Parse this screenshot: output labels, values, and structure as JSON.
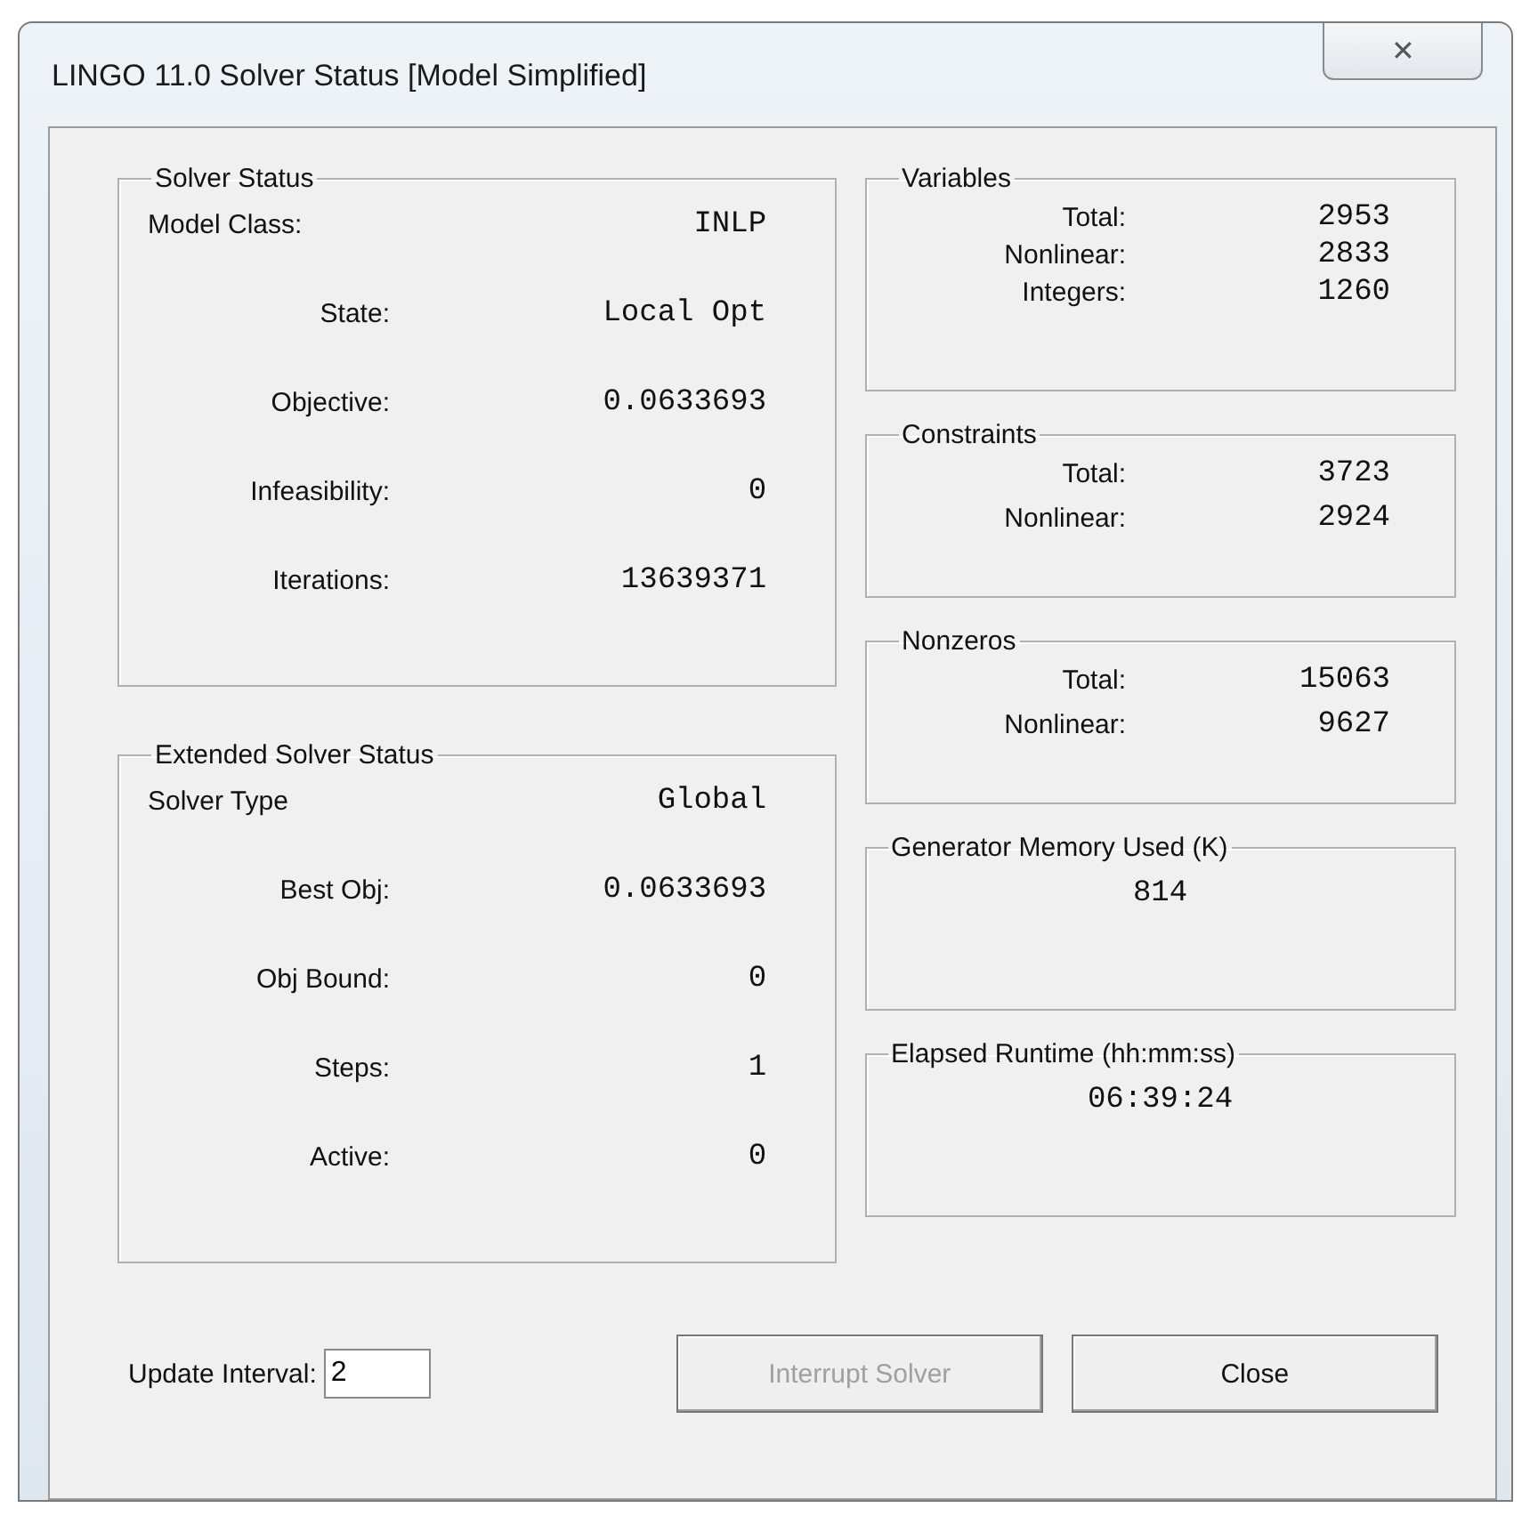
{
  "window": {
    "title": "LINGO 11.0 Solver Status [Model Simplified]",
    "close_button": "✕"
  },
  "solver_status": {
    "title": "Solver Status",
    "rows": [
      {
        "label": "Model Class:",
        "value": "INLP"
      },
      {
        "label": "State:",
        "value": "Local Opt"
      },
      {
        "label": "Objective:",
        "value": "0.0633693"
      },
      {
        "label": "Infeasibility:",
        "value": "0"
      },
      {
        "label": "Iterations:",
        "value": "13639371"
      }
    ]
  },
  "extended_solver_status": {
    "title": "Extended Solver Status",
    "rows": [
      {
        "label": "Solver Type",
        "value": "Global"
      },
      {
        "label": "Best Obj:",
        "value": "0.0633693"
      },
      {
        "label": "Obj Bound:",
        "value": "0"
      },
      {
        "label": "Steps:",
        "value": "1"
      },
      {
        "label": "Active:",
        "value": "0"
      }
    ]
  },
  "variables": {
    "title": "Variables",
    "rows": [
      {
        "label": "Total:",
        "value": "2953"
      },
      {
        "label": "Nonlinear:",
        "value": "2833"
      },
      {
        "label": "Integers:",
        "value": "1260"
      }
    ]
  },
  "constraints": {
    "title": "Constraints",
    "rows": [
      {
        "label": "Total:",
        "value": "3723"
      },
      {
        "label": "Nonlinear:",
        "value": "2924"
      }
    ]
  },
  "nonzeros": {
    "title": "Nonzeros",
    "rows": [
      {
        "label": "Total:",
        "value": "15063"
      },
      {
        "label": "Nonlinear:",
        "value": "9627"
      }
    ]
  },
  "generator_memory": {
    "title": "Generator Memory Used (K)",
    "value": "814"
  },
  "elapsed_runtime": {
    "title": "Elapsed Runtime (hh:mm:ss)",
    "value": "06:39:24"
  },
  "update_interval": {
    "label": "Update Interval:",
    "value": "2"
  },
  "buttons": [
    {
      "label": "Interrupt Solver",
      "disabled": true
    },
    {
      "label": "Close",
      "disabled": false
    }
  ]
}
